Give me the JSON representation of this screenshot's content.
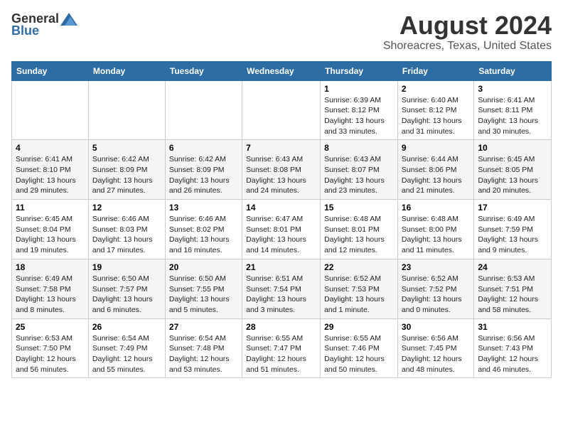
{
  "header": {
    "logo_general": "General",
    "logo_blue": "Blue",
    "title": "August 2024",
    "subtitle": "Shoreacres, Texas, United States"
  },
  "weekdays": [
    "Sunday",
    "Monday",
    "Tuesday",
    "Wednesday",
    "Thursday",
    "Friday",
    "Saturday"
  ],
  "weeks": [
    [
      {
        "day": "",
        "info": ""
      },
      {
        "day": "",
        "info": ""
      },
      {
        "day": "",
        "info": ""
      },
      {
        "day": "",
        "info": ""
      },
      {
        "day": "1",
        "info": "Sunrise: 6:39 AM\nSunset: 8:12 PM\nDaylight: 13 hours\nand 33 minutes."
      },
      {
        "day": "2",
        "info": "Sunrise: 6:40 AM\nSunset: 8:12 PM\nDaylight: 13 hours\nand 31 minutes."
      },
      {
        "day": "3",
        "info": "Sunrise: 6:41 AM\nSunset: 8:11 PM\nDaylight: 13 hours\nand 30 minutes."
      }
    ],
    [
      {
        "day": "4",
        "info": "Sunrise: 6:41 AM\nSunset: 8:10 PM\nDaylight: 13 hours\nand 29 minutes."
      },
      {
        "day": "5",
        "info": "Sunrise: 6:42 AM\nSunset: 8:09 PM\nDaylight: 13 hours\nand 27 minutes."
      },
      {
        "day": "6",
        "info": "Sunrise: 6:42 AM\nSunset: 8:09 PM\nDaylight: 13 hours\nand 26 minutes."
      },
      {
        "day": "7",
        "info": "Sunrise: 6:43 AM\nSunset: 8:08 PM\nDaylight: 13 hours\nand 24 minutes."
      },
      {
        "day": "8",
        "info": "Sunrise: 6:43 AM\nSunset: 8:07 PM\nDaylight: 13 hours\nand 23 minutes."
      },
      {
        "day": "9",
        "info": "Sunrise: 6:44 AM\nSunset: 8:06 PM\nDaylight: 13 hours\nand 21 minutes."
      },
      {
        "day": "10",
        "info": "Sunrise: 6:45 AM\nSunset: 8:05 PM\nDaylight: 13 hours\nand 20 minutes."
      }
    ],
    [
      {
        "day": "11",
        "info": "Sunrise: 6:45 AM\nSunset: 8:04 PM\nDaylight: 13 hours\nand 19 minutes."
      },
      {
        "day": "12",
        "info": "Sunrise: 6:46 AM\nSunset: 8:03 PM\nDaylight: 13 hours\nand 17 minutes."
      },
      {
        "day": "13",
        "info": "Sunrise: 6:46 AM\nSunset: 8:02 PM\nDaylight: 13 hours\nand 16 minutes."
      },
      {
        "day": "14",
        "info": "Sunrise: 6:47 AM\nSunset: 8:01 PM\nDaylight: 13 hours\nand 14 minutes."
      },
      {
        "day": "15",
        "info": "Sunrise: 6:48 AM\nSunset: 8:01 PM\nDaylight: 13 hours\nand 12 minutes."
      },
      {
        "day": "16",
        "info": "Sunrise: 6:48 AM\nSunset: 8:00 PM\nDaylight: 13 hours\nand 11 minutes."
      },
      {
        "day": "17",
        "info": "Sunrise: 6:49 AM\nSunset: 7:59 PM\nDaylight: 13 hours\nand 9 minutes."
      }
    ],
    [
      {
        "day": "18",
        "info": "Sunrise: 6:49 AM\nSunset: 7:58 PM\nDaylight: 13 hours\nand 8 minutes."
      },
      {
        "day": "19",
        "info": "Sunrise: 6:50 AM\nSunset: 7:57 PM\nDaylight: 13 hours\nand 6 minutes."
      },
      {
        "day": "20",
        "info": "Sunrise: 6:50 AM\nSunset: 7:55 PM\nDaylight: 13 hours\nand 5 minutes."
      },
      {
        "day": "21",
        "info": "Sunrise: 6:51 AM\nSunset: 7:54 PM\nDaylight: 13 hours\nand 3 minutes."
      },
      {
        "day": "22",
        "info": "Sunrise: 6:52 AM\nSunset: 7:53 PM\nDaylight: 13 hours\nand 1 minute."
      },
      {
        "day": "23",
        "info": "Sunrise: 6:52 AM\nSunset: 7:52 PM\nDaylight: 13 hours\nand 0 minutes."
      },
      {
        "day": "24",
        "info": "Sunrise: 6:53 AM\nSunset: 7:51 PM\nDaylight: 12 hours\nand 58 minutes."
      }
    ],
    [
      {
        "day": "25",
        "info": "Sunrise: 6:53 AM\nSunset: 7:50 PM\nDaylight: 12 hours\nand 56 minutes."
      },
      {
        "day": "26",
        "info": "Sunrise: 6:54 AM\nSunset: 7:49 PM\nDaylight: 12 hours\nand 55 minutes."
      },
      {
        "day": "27",
        "info": "Sunrise: 6:54 AM\nSunset: 7:48 PM\nDaylight: 12 hours\nand 53 minutes."
      },
      {
        "day": "28",
        "info": "Sunrise: 6:55 AM\nSunset: 7:47 PM\nDaylight: 12 hours\nand 51 minutes."
      },
      {
        "day": "29",
        "info": "Sunrise: 6:55 AM\nSunset: 7:46 PM\nDaylight: 12 hours\nand 50 minutes."
      },
      {
        "day": "30",
        "info": "Sunrise: 6:56 AM\nSunset: 7:45 PM\nDaylight: 12 hours\nand 48 minutes."
      },
      {
        "day": "31",
        "info": "Sunrise: 6:56 AM\nSunset: 7:43 PM\nDaylight: 12 hours\nand 46 minutes."
      }
    ]
  ]
}
